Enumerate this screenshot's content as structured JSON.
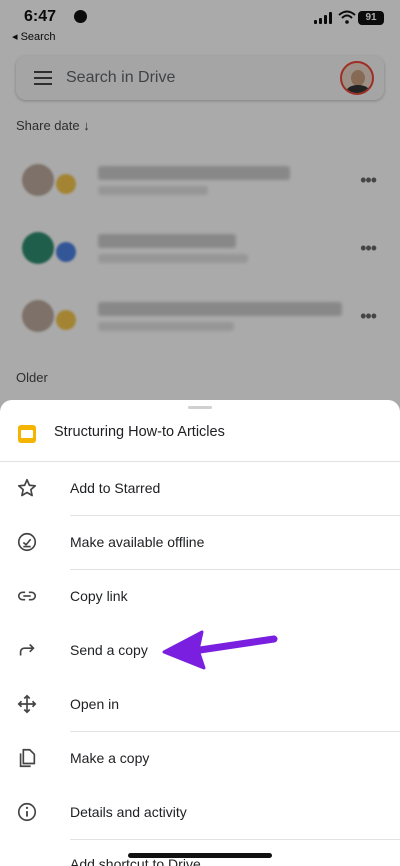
{
  "status_bar": {
    "time": "6:47",
    "battery": "91",
    "back_label": "◂ Search"
  },
  "header": {
    "search_placeholder": "Search in Drive"
  },
  "list": {
    "sort_label": "Share date ↓",
    "section_older": "Older",
    "more_symbol": "•••"
  },
  "sheet": {
    "title": "Structuring How-to Articles",
    "items": [
      {
        "label": "Add to Starred",
        "icon": "star-icon"
      },
      {
        "label": "Make available offline",
        "icon": "offline-icon"
      },
      {
        "label": "Copy link",
        "icon": "link-icon"
      },
      {
        "label": "Send a copy",
        "icon": "share-arrow-icon"
      },
      {
        "label": "Open in",
        "icon": "move-icon"
      },
      {
        "label": "Make a copy",
        "icon": "copy-icon"
      },
      {
        "label": "Details and activity",
        "icon": "info-icon"
      }
    ],
    "partial_item": "Add shortcut to Drive"
  },
  "colors": {
    "annotation_arrow": "#7a1fe0",
    "slides_icon": "#f4b400",
    "scrim": "rgba(0,0,0,0.32)"
  }
}
